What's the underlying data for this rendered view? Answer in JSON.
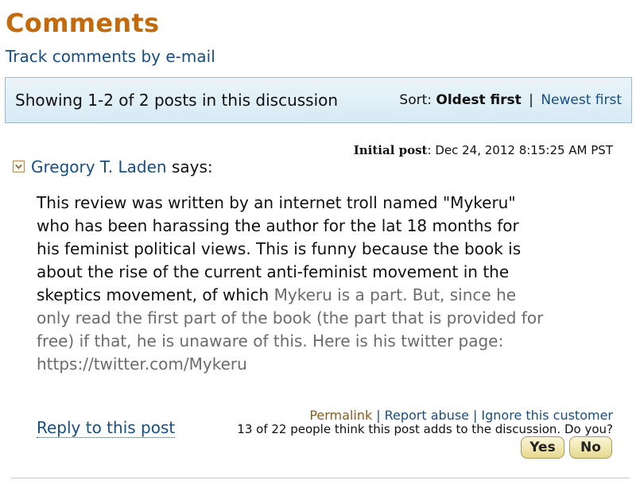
{
  "header": {
    "title": "Comments",
    "track_link": "Track comments by e-mail"
  },
  "discussion_bar": {
    "showing": "Showing 1-2 of 2 posts in this discussion",
    "sort_label": "Sort:",
    "sort_current": "Oldest first",
    "separator": "|",
    "sort_alt": "Newest first"
  },
  "post": {
    "meta_label": "Initial post",
    "meta_sep": ":",
    "date": "Dec 24, 2012 8:15:25 AM PST",
    "author": "Gregory T. Laden",
    "says": "says:",
    "body_main": "This review was written by an internet troll named \"Mykeru\" who has been harassing the author for the lat 18 months for his feminist political views. This is funny because the book is about the rise of the current anti-feminist movement in the skeptics movement, of which",
    "body_faded": "Mykeru is a part. But, since he only read the first part of the book (the part that is provided for free) if that, he is unaware of this. Here is his twitter page: https://twitter.com/Mykeru",
    "permalink": "Permalink",
    "report": "Report abuse",
    "ignore": "Ignore this customer",
    "reply": "Reply to this post",
    "helpful_text": "13 of 22 people think this post adds to the discussion. Do you?",
    "yes": "Yes",
    "no": "No"
  }
}
